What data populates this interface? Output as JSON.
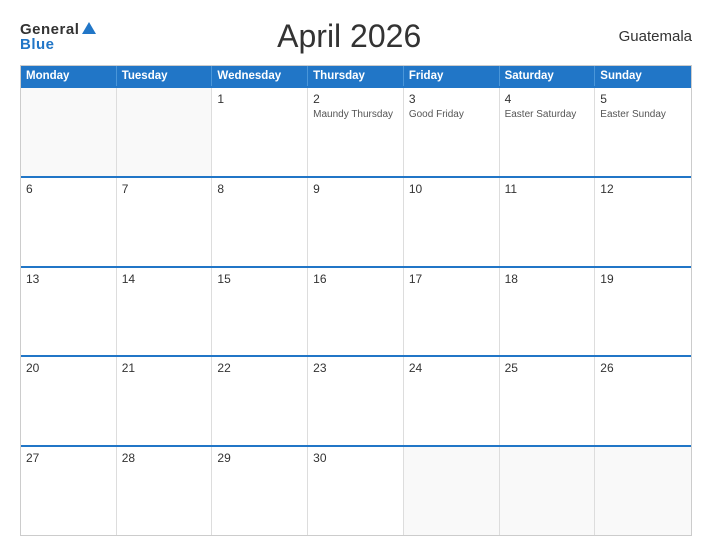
{
  "header": {
    "logo_general": "General",
    "logo_blue": "Blue",
    "title": "April 2026",
    "country": "Guatemala"
  },
  "weekdays": [
    "Monday",
    "Tuesday",
    "Wednesday",
    "Thursday",
    "Friday",
    "Saturday",
    "Sunday"
  ],
  "weeks": [
    [
      {
        "day": "",
        "holiday": ""
      },
      {
        "day": "",
        "holiday": ""
      },
      {
        "day": "1",
        "holiday": ""
      },
      {
        "day": "2",
        "holiday": "Maundy Thursday"
      },
      {
        "day": "3",
        "holiday": "Good Friday"
      },
      {
        "day": "4",
        "holiday": "Easter Saturday"
      },
      {
        "day": "5",
        "holiday": "Easter Sunday"
      }
    ],
    [
      {
        "day": "6",
        "holiday": ""
      },
      {
        "day": "7",
        "holiday": ""
      },
      {
        "day": "8",
        "holiday": ""
      },
      {
        "day": "9",
        "holiday": ""
      },
      {
        "day": "10",
        "holiday": ""
      },
      {
        "day": "11",
        "holiday": ""
      },
      {
        "day": "12",
        "holiday": ""
      }
    ],
    [
      {
        "day": "13",
        "holiday": ""
      },
      {
        "day": "14",
        "holiday": ""
      },
      {
        "day": "15",
        "holiday": ""
      },
      {
        "day": "16",
        "holiday": ""
      },
      {
        "day": "17",
        "holiday": ""
      },
      {
        "day": "18",
        "holiday": ""
      },
      {
        "day": "19",
        "holiday": ""
      }
    ],
    [
      {
        "day": "20",
        "holiday": ""
      },
      {
        "day": "21",
        "holiday": ""
      },
      {
        "day": "22",
        "holiday": ""
      },
      {
        "day": "23",
        "holiday": ""
      },
      {
        "day": "24",
        "holiday": ""
      },
      {
        "day": "25",
        "holiday": ""
      },
      {
        "day": "26",
        "holiday": ""
      }
    ],
    [
      {
        "day": "27",
        "holiday": ""
      },
      {
        "day": "28",
        "holiday": ""
      },
      {
        "day": "29",
        "holiday": ""
      },
      {
        "day": "30",
        "holiday": ""
      },
      {
        "day": "",
        "holiday": ""
      },
      {
        "day": "",
        "holiday": ""
      },
      {
        "day": "",
        "holiday": ""
      }
    ]
  ]
}
